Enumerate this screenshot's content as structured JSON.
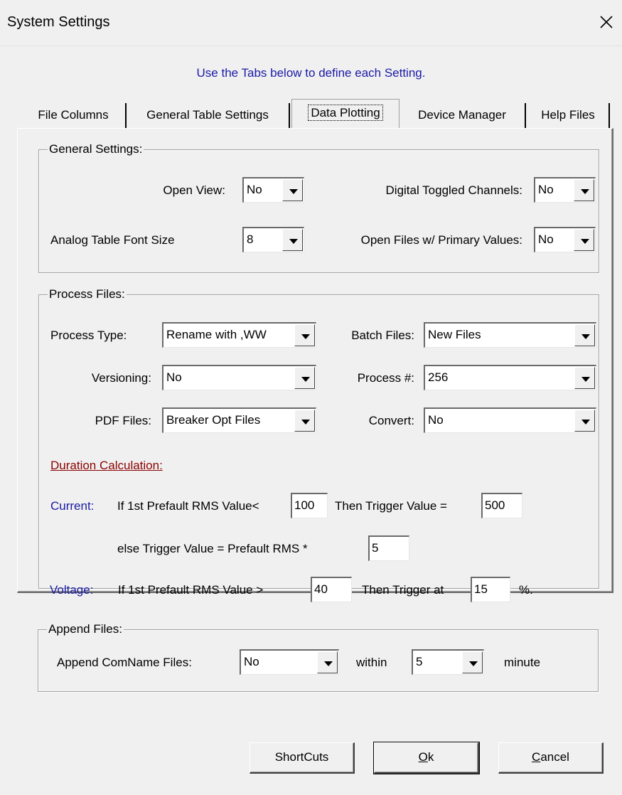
{
  "window": {
    "title": "System Settings"
  },
  "instructions": "Use the Tabs below to define each Setting.",
  "tabs": [
    {
      "label": "File Columns"
    },
    {
      "label": "General Table Settings"
    },
    {
      "label": "Data Plotting"
    },
    {
      "label": "Device Manager"
    },
    {
      "label": "Help Files"
    }
  ],
  "active_tab": "Data Plotting",
  "general": {
    "legend": "General Settings:",
    "open_view_label": "Open View:",
    "open_view_value": "No",
    "digital_label": "Digital Toggled Channels:",
    "digital_value": "No",
    "font_size_label": "Analog Table Font Size",
    "font_size_value": "8",
    "primary_label": "Open Files w/ Primary Values:",
    "primary_value": "No"
  },
  "process": {
    "legend": "Process Files:",
    "type_label": "Process Type:",
    "type_value": "Rename with ,WW",
    "batch_label": "Batch Files:",
    "batch_value": "New Files",
    "versioning_label": "Versioning:",
    "versioning_value": "No",
    "processnum_label": "Process #:",
    "processnum_value": "256",
    "pdf_label": "PDF Files:",
    "pdf_value": "Breaker Opt Files",
    "convert_label": "Convert:",
    "convert_value": "No",
    "duration": {
      "heading": "Duration Calculation:",
      "current_label": "Current:",
      "current_if": "If 1st Prefault RMS Value<",
      "current_threshold": "100",
      "current_then": "Then Trigger Value =",
      "current_trigger": "500",
      "else_text": "else Trigger Value =  Prefault RMS *",
      "else_multiplier": "5",
      "voltage_label": "Voltage:",
      "voltage_if": "If 1st Prefault RMS Value >",
      "voltage_threshold": "40",
      "voltage_then": "Then Trigger at",
      "voltage_percent": "15",
      "percent_sign": "%."
    }
  },
  "append": {
    "legend": "Append Files:",
    "comname_label": "Append ComName Files:",
    "comname_value": "No",
    "within_label": "within",
    "within_value": "5",
    "unit_label": "minute"
  },
  "buttons": {
    "shortcuts": "ShortCuts",
    "ok_mnemonic": "O",
    "ok_rest": "k",
    "cancel_mnemonic": "C",
    "cancel_rest": "ancel"
  }
}
